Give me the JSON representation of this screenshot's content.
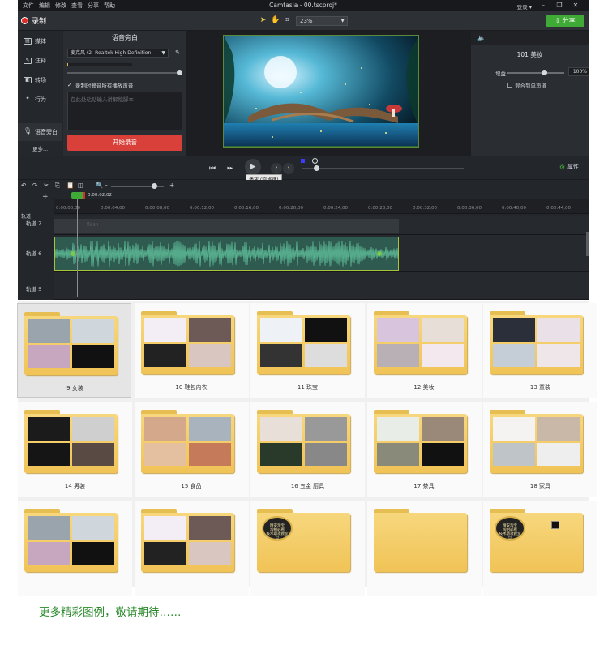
{
  "app": {
    "menu": [
      "文件",
      "编辑",
      "修改",
      "查看",
      "分享",
      "帮助"
    ],
    "title": "Camtasia - 00.tscproj*",
    "login": "登录 ▾",
    "record_label": "录制",
    "zoom": "23%",
    "share_label": "分享",
    "accent": "#3faa35",
    "record_color": "#e02b2b"
  },
  "sidebar": {
    "items": [
      {
        "label": "媒体",
        "icon": "media-icon"
      },
      {
        "label": "注释",
        "icon": "annotation-icon"
      },
      {
        "label": "转场",
        "icon": "transition-icon"
      },
      {
        "label": "行为",
        "icon": "behavior-icon"
      },
      {
        "label": "语音旁白",
        "icon": "microphone-icon"
      }
    ],
    "more": "更多..."
  },
  "voice_panel": {
    "title": "语音旁白",
    "mic_device": "麦克风 (2- Realtek High Definition",
    "record_system_audio": "录制时静音所有播放声音",
    "script_placeholder": "在此处粘贴输入讲解稿脚本",
    "start_button": "开始录音",
    "level": 0.01
  },
  "properties": {
    "clip_title": "101 美妆",
    "gain_label": "增益",
    "gain_value": "100%",
    "mix_mono": "混合到单声道",
    "props_button": "属性"
  },
  "playback": {
    "tooltip": "播放 (空格键)"
  },
  "timeline": {
    "playhead_time": "0:00:02;02",
    "tracks_label": "轨道",
    "ticks": [
      "0:00:00;00",
      "0:00:04;00",
      "0:00:08;00",
      "0:00:12;00",
      "0:00:16;00",
      "0:00:20;00",
      "0:00:24;00",
      "0:00:28;00",
      "0:00:32;00",
      "0:00:36;00",
      "0:00:40;00",
      "0:00:44;00"
    ],
    "tracks": [
      "轨道 7",
      "轨道 6",
      "轨道 5"
    ],
    "top_clip_label": "flash"
  },
  "folders": [
    {
      "label": "9 女装",
      "highlight": true
    },
    {
      "label": "10 鞋包内衣"
    },
    {
      "label": "11 珠宝"
    },
    {
      "label": "12 美妆"
    },
    {
      "label": "13 童装"
    },
    {
      "label": "14 男装"
    },
    {
      "label": "15 食品"
    },
    {
      "label": "16 五金 厨具"
    },
    {
      "label": "17 茶具"
    },
    {
      "label": "18 家具"
    },
    {
      "label": ""
    },
    {
      "label": ""
    },
    {
      "label": ""
    },
    {
      "label": ""
    },
    {
      "label": ""
    }
  ],
  "badge_text": "精安淘宝\n淘拍必看\n技术助攻教室\n☺",
  "footer": "更多精彩图例，敬请期待……"
}
